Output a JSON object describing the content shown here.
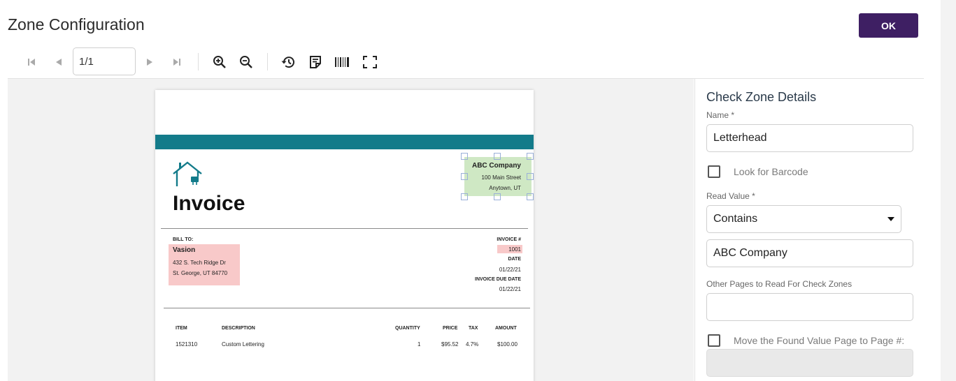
{
  "header": {
    "title": "Zone Configuration",
    "ok_label": "OK"
  },
  "toolbar": {
    "page_value": "1/1",
    "icons": [
      "first-page-icon",
      "prev-page-icon",
      "next-page-icon",
      "last-page-icon",
      "zoom-in-icon",
      "zoom-out-icon",
      "history-icon",
      "note-icon",
      "barcode-icon",
      "fullscreen-icon"
    ]
  },
  "document": {
    "title": "Invoice",
    "company": {
      "name": "ABC Company",
      "street": "100 Main Street",
      "city": "Anytown, UT"
    },
    "bill_to": {
      "label": "BILL TO:",
      "name": "Vasion",
      "address1": "432 S. Tech Ridge Dr",
      "address2": "St. George, UT 84770"
    },
    "meta": {
      "invoice_label": "INVOICE #",
      "invoice_value": "1001",
      "date_label": "DATE",
      "date_value": "01/22/21",
      "due_label": "INVOICE DUE DATE",
      "due_value": "01/22/21"
    },
    "table": {
      "headers": [
        "ITEM",
        "DESCRIPTION",
        "QUANTITY",
        "PRICE",
        "TAX",
        "AMOUNT"
      ],
      "rows": [
        [
          "1521310",
          "Custom Lettering",
          "1",
          "$95.52",
          "4.7%",
          "$100.00"
        ]
      ]
    },
    "colors": {
      "band": "#137b8a",
      "zone_match": "#cfe8c4",
      "zone_other": "#f8c9c9"
    }
  },
  "panel": {
    "title": "Check Zone Details",
    "name_label": "Name *",
    "name_value": "Letterhead",
    "barcode_label": "Look for Barcode",
    "read_value_label": "Read Value *",
    "read_value_selected": "Contains",
    "read_value_text": "ABC Company",
    "other_pages_label": "Other Pages to Read For Check Zones",
    "other_pages_value": "",
    "move_label": "Move the Found Value Page to Page #:",
    "move_value": ""
  },
  "theme": {
    "accent": "#3e1f63"
  }
}
